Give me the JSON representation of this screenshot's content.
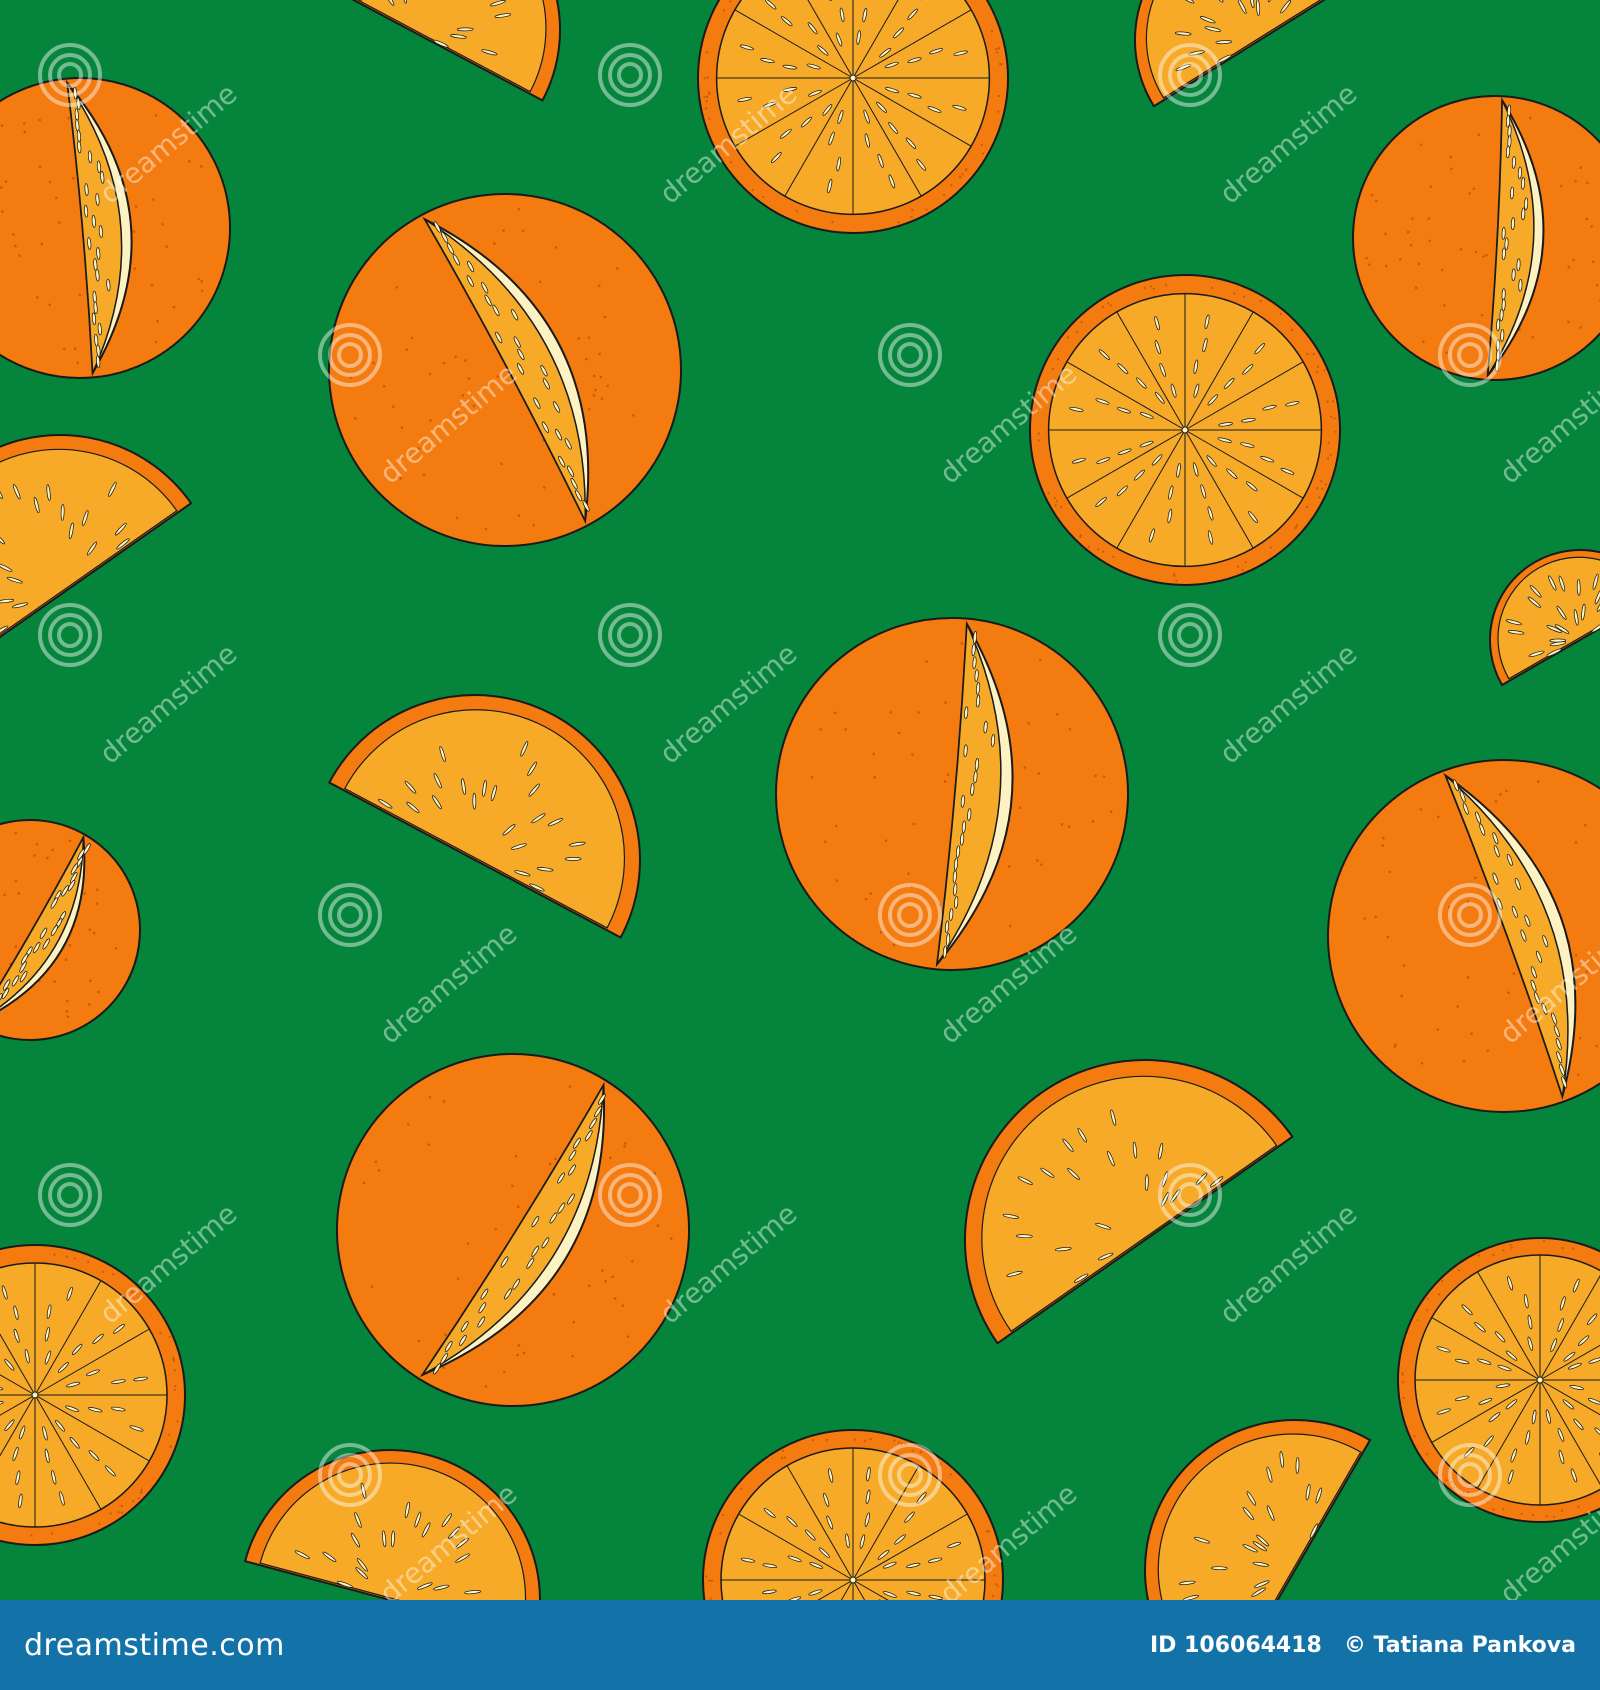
{
  "image": {
    "description_colors": {
      "background": "#05843c",
      "peel": "#f47b0f",
      "peel_dark": "#c95a08",
      "flesh": "#f6aa28",
      "pith": "#fdf3c2",
      "outline": "#1a1a1a",
      "footer": "#1372a8",
      "watermark": "#ffffff"
    }
  },
  "watermark": {
    "text": "dreamstime"
  },
  "footer": {
    "brand": "dreamstime.com",
    "id_label": "ID 106064418",
    "author": "© Tatiana Pankova"
  }
}
